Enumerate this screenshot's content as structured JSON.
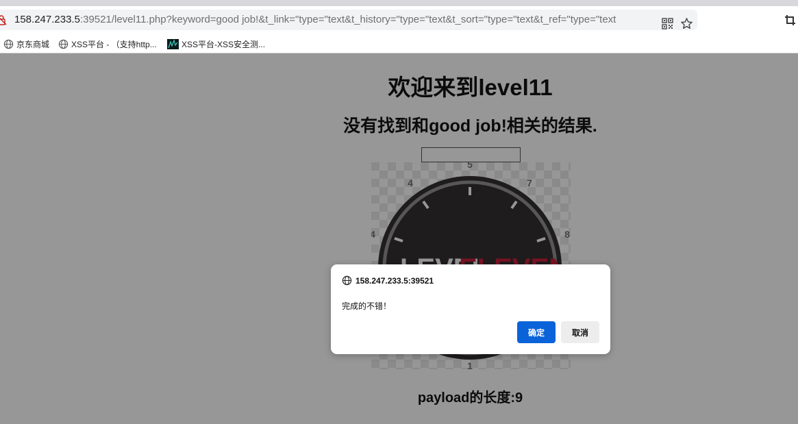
{
  "browser": {
    "url_host": "158.247.233.5",
    "url_rest": ":39521/level11.php?keyword=good job!&t_link=\"type=\"text&t_history=\"type=\"text&t_sort=\"type=\"text&t_ref=\"type=\"text",
    "bookmarks": [
      {
        "label": "京东商城",
        "icon": "globe-icon"
      },
      {
        "label": "XSS平台 - （支持http...",
        "icon": "globe-icon"
      },
      {
        "label": "XSS平台-XSS安全测...",
        "icon": "site-favicon"
      }
    ]
  },
  "page": {
    "title": "欢迎来到level11",
    "result": "没有找到和good job!相关的结果.",
    "keyword_value": "",
    "payload_length": "payload的长度:9",
    "image": {
      "dial_numbers": [
        "1",
        "4",
        "5",
        "6",
        "7",
        "8"
      ],
      "text_left": "LEVEL",
      "text_right": "ELEVEN"
    }
  },
  "dialog": {
    "origin": "158.247.233.5:39521",
    "message": "完成的不错！",
    "ok_label": "确定",
    "cancel_label": "取消"
  },
  "colors": {
    "accent_button": "#0a63d8",
    "overlay": "#181818",
    "dial_dark": "#231f20",
    "dial_red": "#c8102e"
  }
}
